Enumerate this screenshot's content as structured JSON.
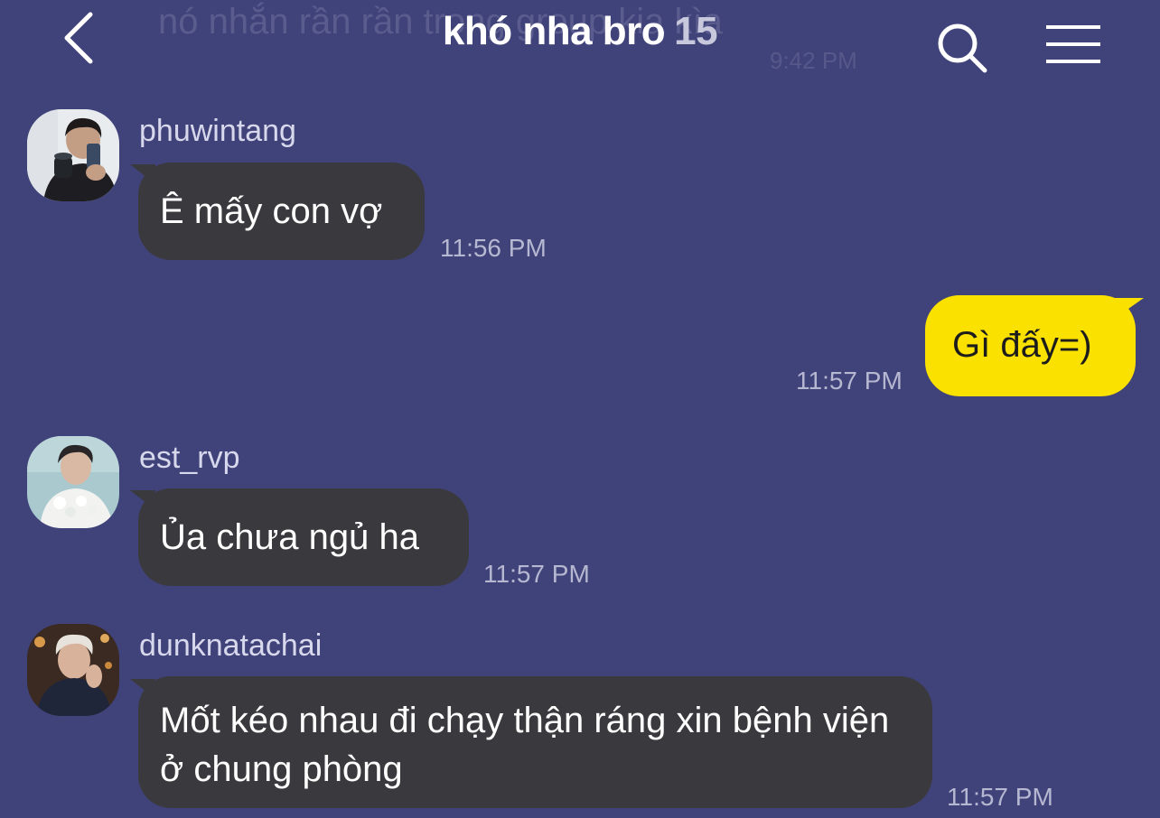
{
  "header": {
    "title": "khó nha bro",
    "member_count": "15",
    "ghost_message": "nó nhắn rần rần trong group kia kìa",
    "ghost_time": "9:42 PM",
    "back_icon": "chevron-left-icon",
    "search_icon": "search-icon",
    "menu_icon": "hamburger-menu-icon"
  },
  "messages": [
    {
      "sender": "phuwintang",
      "text": "Ê mấy con vợ",
      "time": "11:56 PM"
    },
    {
      "sender": "me",
      "text": "Gì đấy=)",
      "time": "11:57 PM"
    },
    {
      "sender": "est_rvp",
      "text": "Ủa chưa ngủ ha",
      "time": "11:57 PM"
    },
    {
      "sender": "dunknatachai",
      "text": "Mốt kéo nhau đi chạy thận ráng xin bệnh viện ở chung phòng",
      "time": "11:57 PM"
    }
  ],
  "colors": {
    "background": "#40427a",
    "incoming_bubble": "#3a3a3e",
    "outgoing_bubble": "#fae100"
  }
}
